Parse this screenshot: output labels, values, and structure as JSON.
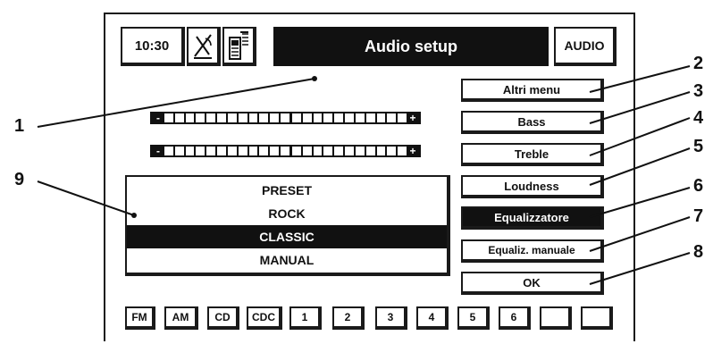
{
  "header": {
    "clock": "10:30",
    "title": "Audio setup",
    "mode": "AUDIO"
  },
  "menu": [
    {
      "label": "Altri menu",
      "active": false
    },
    {
      "label": "Bass",
      "active": false
    },
    {
      "label": "Treble",
      "active": false
    },
    {
      "label": "Loudness",
      "active": false
    },
    {
      "label": "Equalizzatore",
      "active": true
    },
    {
      "label": "Equaliz. manuale",
      "active": false
    },
    {
      "label": "OK",
      "active": false
    }
  ],
  "sliders": [
    {
      "minus": "-",
      "plus": "+",
      "level": 0.5
    },
    {
      "minus": "-",
      "plus": "+",
      "level": 0.5
    }
  ],
  "presets": [
    {
      "label": "PRESET",
      "selected": false
    },
    {
      "label": "ROCK",
      "selected": false
    },
    {
      "label": "CLASSIC",
      "selected": true
    },
    {
      "label": "MANUAL",
      "selected": false
    }
  ],
  "sources": [
    "FM",
    "AM",
    "CD",
    "CDC",
    "1",
    "2",
    "3",
    "4",
    "5",
    "6",
    "",
    ""
  ],
  "callouts": [
    "1",
    "2",
    "3",
    "4",
    "5",
    "6",
    "7",
    "8",
    "9"
  ],
  "icons": [
    "satellite-icon",
    "phone-icon"
  ]
}
